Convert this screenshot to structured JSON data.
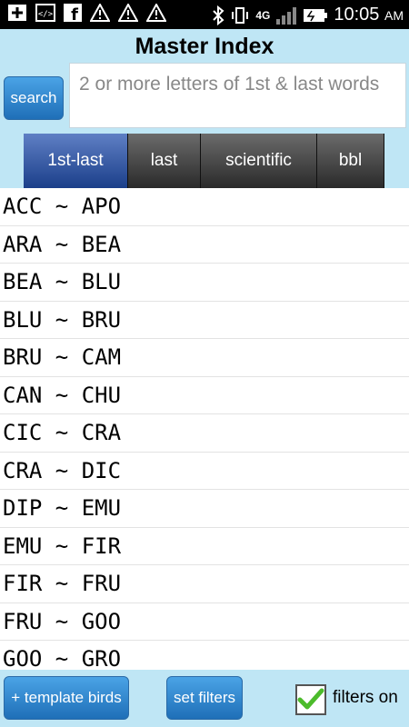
{
  "status_bar": {
    "time": "10:05",
    "ampm": "AM",
    "network": "4G"
  },
  "header": {
    "title": "Master Index",
    "search_label": "search",
    "search_placeholder": "2 or more letters of 1st & last words"
  },
  "tabs": [
    {
      "label": "1st-last",
      "active": true
    },
    {
      "label": "last",
      "active": false
    },
    {
      "label": "scientific",
      "active": false
    },
    {
      "label": "bbl",
      "active": false
    }
  ],
  "index_rows": [
    "ACC ~ APO",
    "ARA ~ BEA",
    "BEA ~ BLU",
    "BLU ~ BRU",
    "BRU ~ CAM",
    "CAN ~ CHU",
    "CIC ~ CRA",
    "CRA ~ DIC",
    "DIP ~ EMU",
    "EMU ~ FIR",
    "FIR ~ FRU",
    "FRU ~ GOO",
    "GOO ~ GRO"
  ],
  "bottom_bar": {
    "template_label": "+ template birds",
    "set_filters_label": "set filters",
    "filters_on_label": "filters on",
    "filters_on_checked": true
  },
  "colors": {
    "background": "#bfe6f5",
    "button_blue": "#2f84cc",
    "active_tab": "#2a4f9a",
    "check_green": "#4cbb2b"
  }
}
